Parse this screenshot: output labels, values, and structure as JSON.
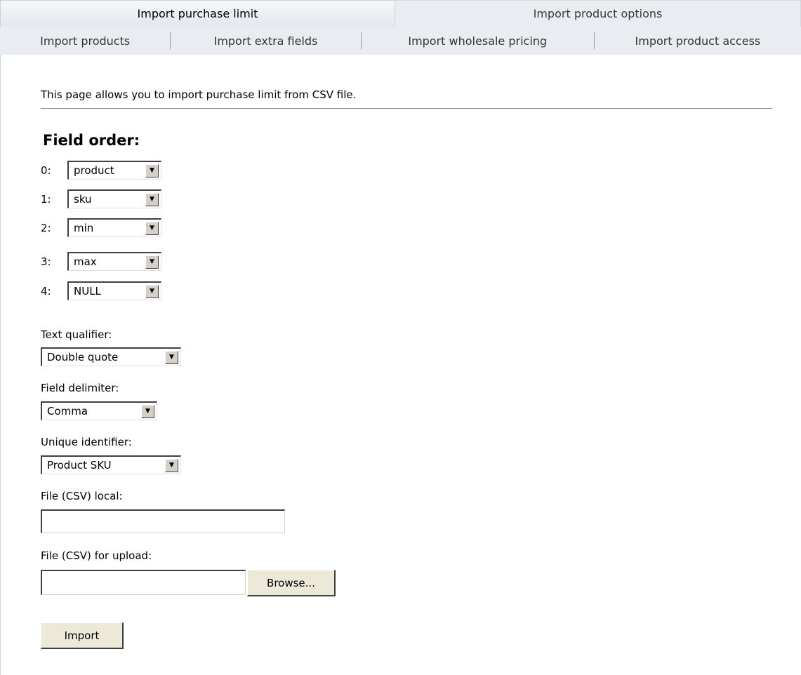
{
  "tabs_top": [
    {
      "label": "Import purchase limit",
      "active": true
    },
    {
      "label": "Import product options",
      "active": false
    }
  ],
  "tabs_sub": [
    {
      "label": "Import products"
    },
    {
      "label": "Import extra fields"
    },
    {
      "label": "Import wholesale pricing"
    },
    {
      "label": "Import product access"
    }
  ],
  "intro": "This page allows you to import purchase limit from CSV file.",
  "field_order": {
    "heading": "Field order:",
    "rows": [
      {
        "index": "0:",
        "value": "product"
      },
      {
        "index": "1:",
        "value": "sku"
      },
      {
        "index": "2:",
        "value": "min"
      },
      {
        "index": "3:",
        "value": "max"
      },
      {
        "index": "4:",
        "value": "NULL"
      }
    ]
  },
  "text_qualifier": {
    "label": "Text qualifier:",
    "value": "Double quote"
  },
  "field_delimiter": {
    "label": "Field delimiter:",
    "value": "Comma"
  },
  "unique_identifier": {
    "label": "Unique identifier:",
    "value": "Product SKU"
  },
  "file_local": {
    "label": "File (CSV) local:",
    "value": ""
  },
  "file_upload": {
    "label": "File (CSV) for upload:",
    "value": "",
    "browse_label": "Browse..."
  },
  "import_button": "Import",
  "icons": {
    "dropdown": "chevron-down-icon"
  }
}
